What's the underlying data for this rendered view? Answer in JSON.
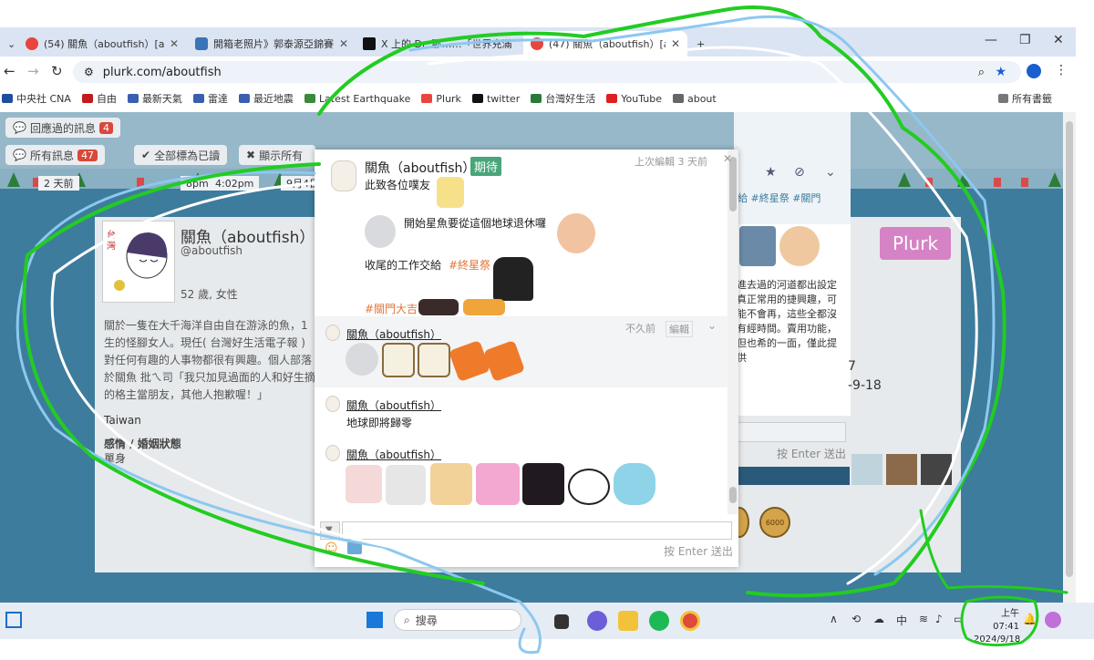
{
  "browser": {
    "tabs": [
      {
        "label": "(54) 關魚（aboutfish）[about",
        "color": "#e8453c"
      },
      {
        "label": "開箱老照片》郭泰源亞錦賽主投",
        "color": "#3b73b8"
      },
      {
        "label": "X 上的 Dr. 那……「世界充滿",
        "color": "#111111"
      },
      {
        "label": "(47) 關魚（aboutfish）[about",
        "color": "#e8453c"
      }
    ],
    "address": "plurk.com/aboutfish",
    "bookmarks": [
      {
        "label": "中央社 CNA",
        "color": "#1f4ea1"
      },
      {
        "label": "自由",
        "color": "#c21b1b"
      },
      {
        "label": "最新天氣",
        "color": "#3a5fb0"
      },
      {
        "label": "雷達",
        "color": "#3a5fb0"
      },
      {
        "label": "最近地震",
        "color": "#3a5fb0"
      },
      {
        "label": "Latest Earthquake",
        "color": "#3a8a3a"
      },
      {
        "label": "Plurk",
        "color": "#e8453c"
      },
      {
        "label": "twitter",
        "color": "#111111"
      },
      {
        "label": "台灣好生活",
        "color": "#2a7a3a"
      },
      {
        "label": "YouTube",
        "color": "#e02020"
      },
      {
        "label": "about",
        "color": "#666666"
      }
    ],
    "all_bookmarks": "所有書籤"
  },
  "toolbar": {
    "replied": "回應過的訊息",
    "replied_count": "4",
    "all_msgs": "所有訊息",
    "all_count": "47",
    "mark_read": "全部標為已讀",
    "show_all": "顯示所有"
  },
  "timeline": {
    "t1": "2 天前",
    "t2": "8pm",
    "t3": "4:02pm",
    "t4": "9月4日"
  },
  "profile": {
    "name": "關魚（aboutfish）",
    "handle": "@aboutfish",
    "age": "52 歲, 女性",
    "bio": "關於一隻在大千海洋自由自在游泳的魚，1生的怪腳女人。現任( 台灣好生活電子報 )對任何有趣的人事物都很有興趣。個人部落於關魚 批ㄟ司「我只加見過面的人和好生摘的格主當朋友，其他人抱歉喔！」",
    "country": "Taiwan",
    "relationship_label": "感情 / 婚姻狀態",
    "relationship": "單身"
  },
  "right": {
    "tags": "給 #終星祭 #關門",
    "plurk_button": "Plurk",
    "text": "進去過的河道都出設定真正常用的捷興趣，可能不會再，這些全都沒有經時間。賣用功能，但也希的一面，僅此提供",
    "num1": "7",
    "num2": "-9-18",
    "enter_hint": "按 Enter 送出",
    "badge": "6000"
  },
  "modal": {
    "last_edit": "上次編輯 3 天前",
    "post_author": "關魚（aboutfish）",
    "post_tag": "期待",
    "lines": [
      "此致各位噗友",
      "開始星魚要從這個地球退休囉",
      "收尾的工作交給",
      "#終星祭",
      "#關門大吉"
    ],
    "r1_author": "關魚（aboutfish）",
    "r1_time": "不久前",
    "r1_edit": "編輯",
    "r2_author": "關魚（aboutfish）",
    "r2_text": "地球即將歸零",
    "r3_author": "關魚（aboutfish）",
    "enter_hint": "按 Enter 送出"
  },
  "taskbar": {
    "search": "搜尋",
    "ime": "中",
    "time": "上午 07:41",
    "date": "2024/9/18"
  },
  "colors": {
    "page_bg": "#3d7c9c",
    "tag_color": "#e0763a",
    "plurk_pink": "#d583c4",
    "scribble_green": "#22cc22",
    "scribble_blue": "#8cc8f0"
  }
}
